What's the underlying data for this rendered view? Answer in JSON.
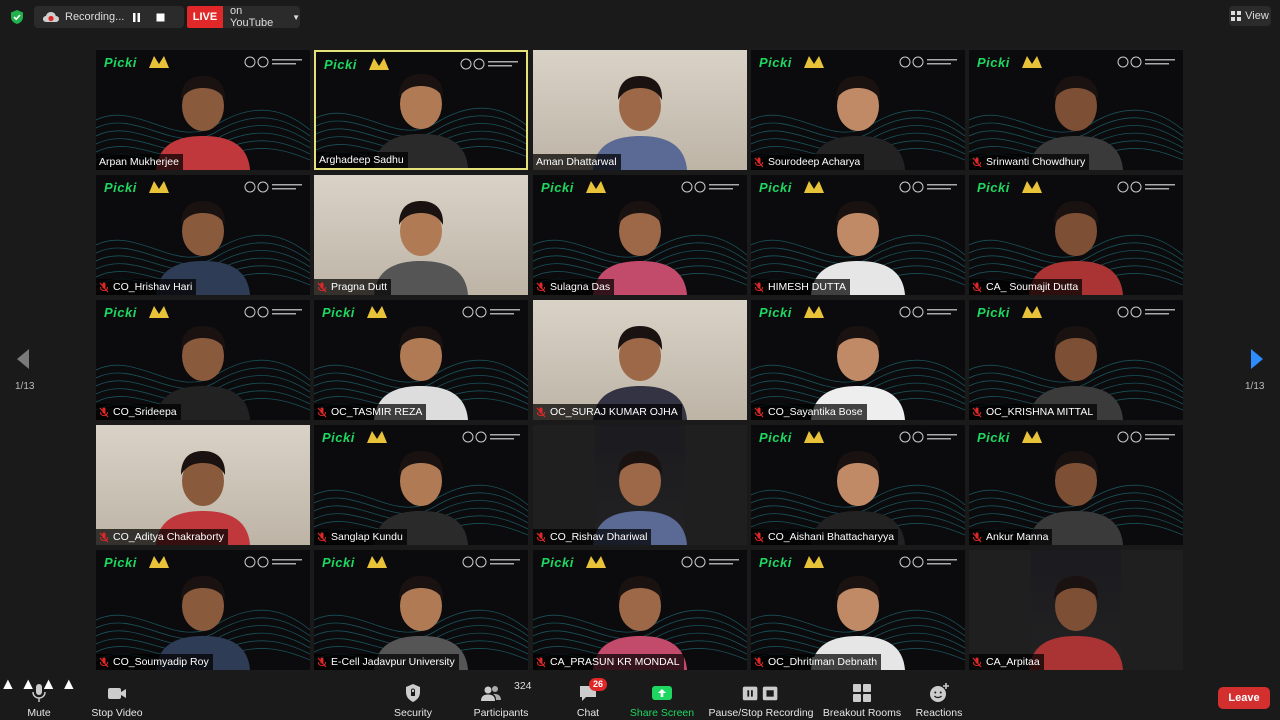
{
  "recording": {
    "label": "Recording...",
    "live_label": "LIVE",
    "stream_label": "on YouTube"
  },
  "view": {
    "label": "View"
  },
  "pagination": {
    "prev": "1/13",
    "next": "1/13"
  },
  "participants_grid": [
    {
      "name": "Arpan Mukherjee",
      "muted": false,
      "bg": "branded",
      "active": false
    },
    {
      "name": "Arghadeep Sadhu",
      "muted": false,
      "bg": "branded",
      "active": true
    },
    {
      "name": "Aman Dhattarwal",
      "muted": false,
      "bg": "room",
      "active": false
    },
    {
      "name": "Sourodeep Acharya",
      "muted": true,
      "bg": "branded",
      "active": false
    },
    {
      "name": "Srinwanti Chowdhury",
      "muted": true,
      "bg": "branded",
      "active": false
    },
    {
      "name": "CO_Hrishav Hari",
      "muted": true,
      "bg": "branded",
      "active": false
    },
    {
      "name": "Pragna Dutt",
      "muted": true,
      "bg": "room",
      "active": false
    },
    {
      "name": "Sulagna Das",
      "muted": true,
      "bg": "branded",
      "active": false
    },
    {
      "name": "HIMESH DUTTA",
      "muted": true,
      "bg": "branded",
      "active": false
    },
    {
      "name": "CA_ Soumajit Dutta",
      "muted": true,
      "bg": "branded",
      "active": false
    },
    {
      "name": "CO_Srideepa",
      "muted": true,
      "bg": "branded",
      "active": false
    },
    {
      "name": "OC_TASMIR REZA",
      "muted": true,
      "bg": "branded",
      "active": false
    },
    {
      "name": "OC_SURAJ KUMAR OJHA",
      "muted": true,
      "bg": "room",
      "active": false
    },
    {
      "name": "CO_Sayantika Bose",
      "muted": true,
      "bg": "branded",
      "active": false
    },
    {
      "name": "OC_KRISHNA MITTAL",
      "muted": true,
      "bg": "branded",
      "active": false
    },
    {
      "name": "CO_Aditya Chakraborty",
      "muted": true,
      "bg": "room",
      "active": false
    },
    {
      "name": "Sanglap Kundu",
      "muted": true,
      "bg": "branded",
      "active": false
    },
    {
      "name": "CO_Rishav Dhariwal",
      "muted": true,
      "bg": "narrow",
      "active": false
    },
    {
      "name": "CO_Aishani Bhattacharyya",
      "muted": true,
      "bg": "branded",
      "active": false
    },
    {
      "name": "Ankur Manna",
      "muted": true,
      "bg": "branded",
      "active": false
    },
    {
      "name": "CO_Soumyadip Roy",
      "muted": true,
      "bg": "branded",
      "active": false
    },
    {
      "name": "E-Cell Jadavpur University",
      "muted": true,
      "bg": "branded",
      "active": false
    },
    {
      "name": "CA_PRASUN KR MONDAL",
      "muted": true,
      "bg": "branded",
      "active": false
    },
    {
      "name": "OC_Dhritiman Debnath",
      "muted": true,
      "bg": "branded",
      "active": false
    },
    {
      "name": "CA_Arpitaa",
      "muted": true,
      "bg": "narrow",
      "active": false
    }
  ],
  "tile_brand": {
    "logo_text": "Picki"
  },
  "toolbar": {
    "mute": "Mute",
    "stop_video": "Stop Video",
    "security": "Security",
    "participants": "Participants",
    "participants_count": "324",
    "chat": "Chat",
    "chat_badge": "26",
    "share_screen": "Share Screen",
    "pause_stop_recording": "Pause/Stop Recording",
    "breakout_rooms": "Breakout Rooms",
    "reactions": "Reactions",
    "leave": "Leave"
  },
  "colors": {
    "active_speaker": "#e6e27a",
    "live_red": "#e02828",
    "share_green": "#1ed760",
    "leave_red": "#d32f2f"
  }
}
